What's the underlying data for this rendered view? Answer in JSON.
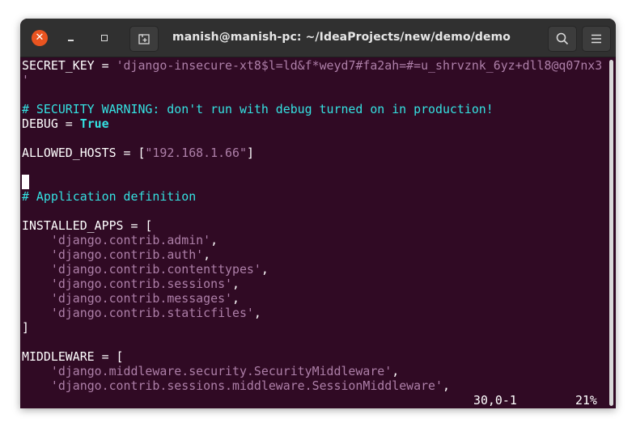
{
  "window": {
    "title": "manish@manish-pc: ~/IdeaProjects/new/demo/demo",
    "close_glyph": "✕",
    "icons": [
      "close-icon",
      "minimize-icon",
      "maximize-icon",
      "new-tab-icon",
      "search-icon",
      "hamburger-menu-icon"
    ]
  },
  "colors": {
    "terminal_bg": "#300a24",
    "titlebar_bg": "#303030",
    "close_button": "#e95420",
    "string": "#ad7fa8",
    "comment": "#34e2e2",
    "text": "#ffffff"
  },
  "editor": {
    "secret_key_name": "SECRET_KEY",
    "assign": " = ",
    "secret_key_value": "'django-insecure-xt8$l=ld&f*weyd7#fa2ah=#=u_shrvznk_6yz+dll8@q07nx3",
    "secret_key_wrap": "'",
    "security_comment": "# SECURITY WARNING: don't run with debug turned on in production!",
    "debug_name": "DEBUG",
    "debug_value": "True",
    "allowed_hosts_name": "ALLOWED_HOSTS",
    "allowed_hosts_open": "[",
    "allowed_hosts_value": "\"192.168.1.66\"",
    "allowed_hosts_close": "]",
    "app_comment": "# Application definition",
    "installed_apps_open": "INSTALLED_APPS = [",
    "installed_apps": [
      "'django.contrib.admin'",
      "'django.contrib.auth'",
      "'django.contrib.contenttypes'",
      "'django.contrib.sessions'",
      "'django.contrib.messages'",
      "'django.contrib.staticfiles'"
    ],
    "list_separator": ",",
    "list_close": "]",
    "middleware_open": "MIDDLEWARE = [",
    "middleware": [
      "'django.middleware.security.SecurityMiddleware'",
      "'django.contrib.sessions.middleware.SessionMiddleware'"
    ]
  },
  "status": {
    "position": "30,0-1",
    "percent": "21%"
  }
}
